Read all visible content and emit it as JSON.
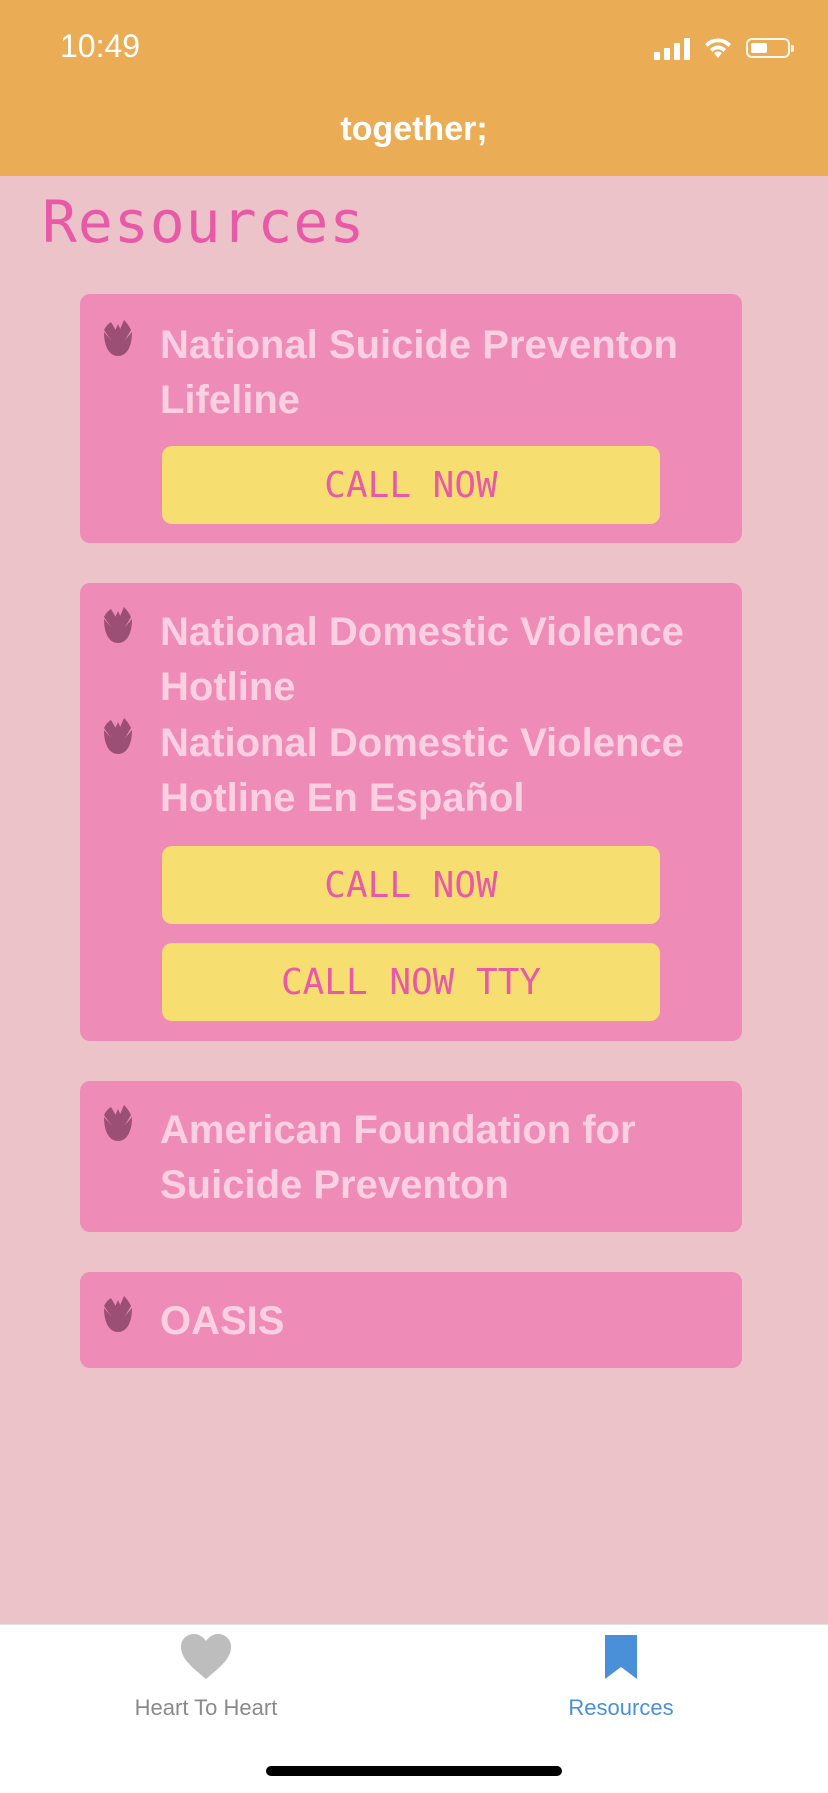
{
  "status_bar": {
    "time": "10:49"
  },
  "header": {
    "title": "together;"
  },
  "page": {
    "heading": "Resources"
  },
  "resources": [
    {
      "name": "National Suicide Preventon Lifeline",
      "buttons": [
        "CALL NOW"
      ]
    },
    {
      "name": "National Domestic Violence Hotline"
    },
    {
      "name": "National Domestic Violence Hotline En Español",
      "buttons": [
        "CALL NOW",
        "CALL NOW TTY"
      ]
    },
    {
      "name": "American Foundation for Suicide Preventon"
    },
    {
      "name": "OASIS"
    }
  ],
  "tabbar": {
    "tabs": [
      {
        "label": "Heart To Heart",
        "icon": "heart-icon",
        "selected": false
      },
      {
        "label": "Resources",
        "icon": "bookmark-icon",
        "selected": true
      }
    ]
  },
  "colors": {
    "header": "#eaad55",
    "background": "#ecc3c9",
    "card": "#ee8bb7",
    "card_text": "#fbd0e2",
    "button": "#f7de70",
    "accent_pink": "#e85aa8",
    "rose_icon": "#9b4f75",
    "tab_selected": "#4a90d9",
    "tab_unselected": "#bdbdbd"
  }
}
